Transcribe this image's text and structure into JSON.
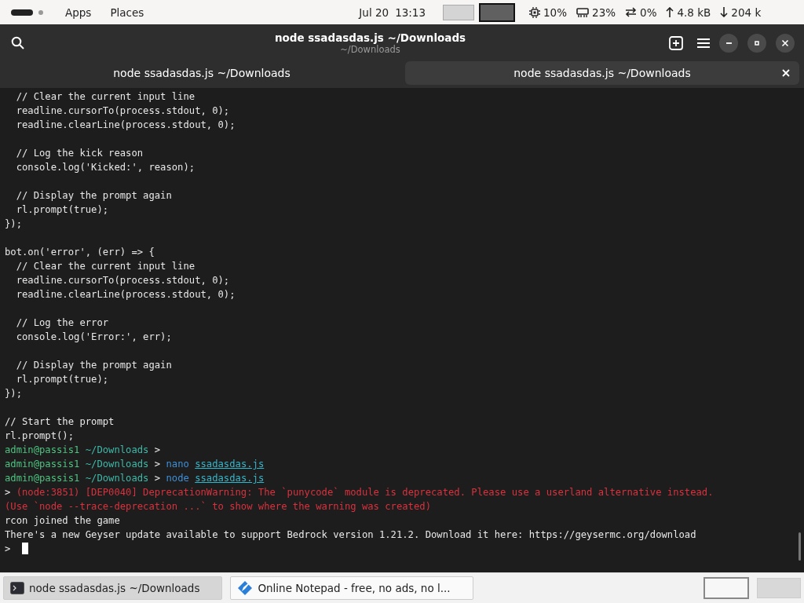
{
  "top_bar": {
    "menus": [
      "Apps",
      "Places"
    ],
    "date": "Jul 20",
    "time": "13:13",
    "workspaces": [
      {
        "selected": false
      },
      {
        "selected": true
      }
    ],
    "indicators": [
      {
        "kind": "cpu",
        "text": "10%"
      },
      {
        "kind": "memory",
        "text": "23%"
      },
      {
        "kind": "swap",
        "text": "0%"
      },
      {
        "kind": "upload",
        "text": "4.8 kB"
      },
      {
        "kind": "download",
        "text": "204 k"
      }
    ]
  },
  "window": {
    "title": "node ssadasdas.js ~/Downloads",
    "subtitle": "~/Downloads"
  },
  "tabs": [
    {
      "label": "node ssadasdas.js ~/Downloads",
      "selected": false
    },
    {
      "label": "node ssadasdas.js ~/Downloads",
      "selected": true
    }
  ],
  "terminal": {
    "lines": [
      {
        "kind": "text",
        "segments": [
          {
            "kind": "plain",
            "text": "  // Clear the current input line"
          }
        ]
      },
      {
        "kind": "text",
        "segments": [
          {
            "kind": "plain",
            "text": "  readline.cursorTo(process.stdout, 0);"
          }
        ]
      },
      {
        "kind": "text",
        "segments": [
          {
            "kind": "plain",
            "text": "  readline.clearLine(process.stdout, 0);"
          }
        ]
      },
      {
        "kind": "blank"
      },
      {
        "kind": "text",
        "segments": [
          {
            "kind": "plain",
            "text": "  // Log the kick reason"
          }
        ]
      },
      {
        "kind": "text",
        "segments": [
          {
            "kind": "plain",
            "text": "  console.log('Kicked:', reason);"
          }
        ]
      },
      {
        "kind": "blank"
      },
      {
        "kind": "text",
        "segments": [
          {
            "kind": "plain",
            "text": "  // Display the prompt again"
          }
        ]
      },
      {
        "kind": "text",
        "segments": [
          {
            "kind": "plain",
            "text": "  rl.prompt(true);"
          }
        ]
      },
      {
        "kind": "text",
        "segments": [
          {
            "kind": "plain",
            "text": "});"
          }
        ]
      },
      {
        "kind": "blank"
      },
      {
        "kind": "text",
        "segments": [
          {
            "kind": "plain",
            "text": "bot.on('error', (err) => {"
          }
        ]
      },
      {
        "kind": "text",
        "segments": [
          {
            "kind": "plain",
            "text": "  // Clear the current input line"
          }
        ]
      },
      {
        "kind": "text",
        "segments": [
          {
            "kind": "plain",
            "text": "  readline.cursorTo(process.stdout, 0);"
          }
        ]
      },
      {
        "kind": "text",
        "segments": [
          {
            "kind": "plain",
            "text": "  readline.clearLine(process.stdout, 0);"
          }
        ]
      },
      {
        "kind": "blank"
      },
      {
        "kind": "text",
        "segments": [
          {
            "kind": "plain",
            "text": "  // Log the error"
          }
        ]
      },
      {
        "kind": "text",
        "segments": [
          {
            "kind": "plain",
            "text": "  console.log('Error:', err);"
          }
        ]
      },
      {
        "kind": "blank"
      },
      {
        "kind": "text",
        "segments": [
          {
            "kind": "plain",
            "text": "  // Display the prompt again"
          }
        ]
      },
      {
        "kind": "text",
        "segments": [
          {
            "kind": "plain",
            "text": "  rl.prompt(true);"
          }
        ]
      },
      {
        "kind": "text",
        "segments": [
          {
            "kind": "plain",
            "text": "});"
          }
        ]
      },
      {
        "kind": "blank"
      },
      {
        "kind": "text",
        "segments": [
          {
            "kind": "plain",
            "text": "// Start the prompt"
          }
        ]
      },
      {
        "kind": "text",
        "segments": [
          {
            "kind": "plain",
            "text": "rl.prompt();"
          }
        ]
      },
      {
        "kind": "text",
        "segments": [
          {
            "kind": "user",
            "text": "admin@passis1"
          },
          {
            "kind": "path",
            "text": "~/Downloads"
          },
          {
            "kind": "plain",
            "text": ">"
          }
        ]
      },
      {
        "kind": "text",
        "segments": [
          {
            "kind": "user",
            "text": "admin@passis1"
          },
          {
            "kind": "path",
            "text": "~/Downloads"
          },
          {
            "kind": "plain",
            "text": ">"
          },
          {
            "kind": "command",
            "text": "nano"
          },
          {
            "kind": "file",
            "text": "ssadasdas.js"
          }
        ]
      },
      {
        "kind": "text",
        "segments": [
          {
            "kind": "user",
            "text": "admin@passis1"
          },
          {
            "kind": "path",
            "text": "~/Downloads"
          },
          {
            "kind": "plain",
            "text": ">"
          },
          {
            "kind": "command",
            "text": "node"
          },
          {
            "kind": "file",
            "text": "ssadasdas.js"
          }
        ]
      },
      {
        "kind": "text",
        "segments": [
          {
            "kind": "plain",
            "text": ">"
          },
          {
            "kind": "error",
            "text": "(node:3851) [DEP0040] DeprecationWarning: The `punycode` module is deprecated. Please use a userland alternative instead."
          }
        ]
      },
      {
        "kind": "text",
        "segments": [
          {
            "kind": "error",
            "text": "(Use `node --trace-deprecation ...` to show where the warning was created)"
          }
        ]
      },
      {
        "kind": "text",
        "segments": [
          {
            "kind": "plain",
            "text": "rcon joined the game"
          }
        ]
      },
      {
        "kind": "text",
        "segments": [
          {
            "kind": "plain",
            "text": "There's a new Geyser update available to support Bedrock version 1.21.2. Download it here: https://geysermc.org/download"
          }
        ]
      },
      {
        "kind": "text",
        "cursor": true,
        "segments": [
          {
            "kind": "plain",
            "text": ">"
          }
        ]
      }
    ]
  },
  "taskbar": {
    "tasks": [
      {
        "label": "node ssadasdas.js ~/Downloads",
        "kind": "terminal",
        "selected": true
      },
      {
        "label": "Online Notepad - free, no ads, no l...",
        "kind": "notepad",
        "selected": false
      }
    ],
    "workspaces": [
      {
        "selected": true
      },
      {
        "selected": false
      }
    ]
  }
}
